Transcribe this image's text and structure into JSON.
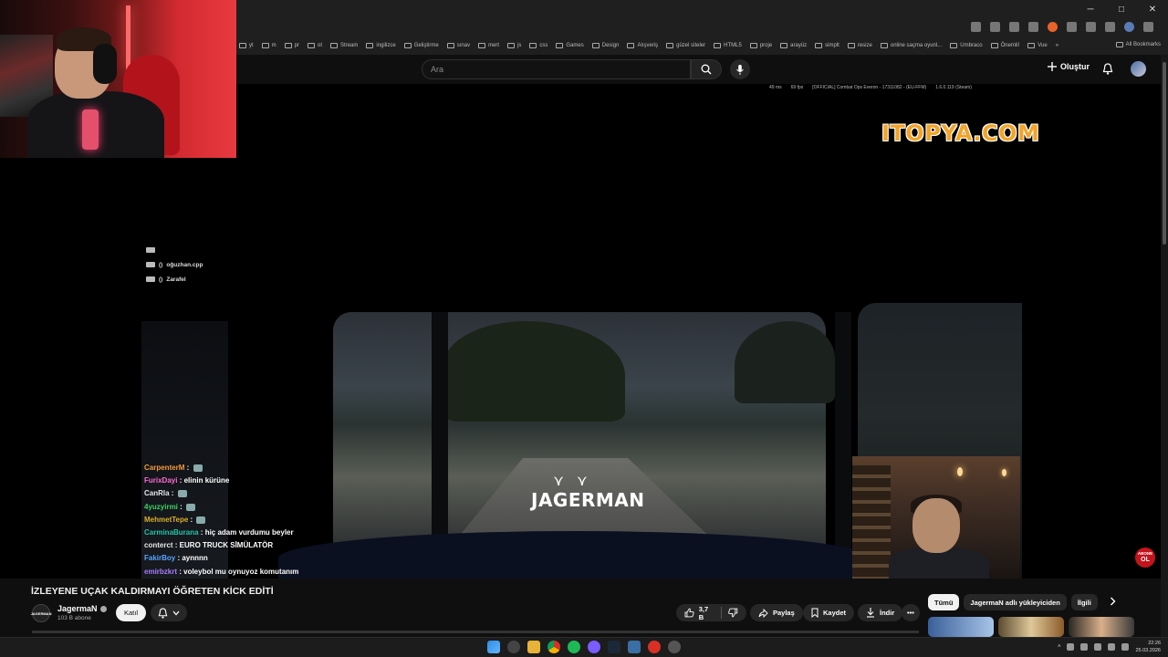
{
  "browser": {
    "controls": [
      "─",
      "□",
      "✕"
    ],
    "bookmarks": [
      "yt",
      "m",
      "pr",
      "ot",
      "Stream",
      "ingilizce",
      "Geliştirme",
      "sınav",
      "mert",
      "js",
      "css",
      "Games",
      "Design",
      "Alışveriş",
      "güzel siteler",
      "HTML5",
      "proje",
      "arayüz",
      "simplt",
      "resize",
      "online saçma oyunl...",
      "Umbraco",
      "Önemli!",
      "Vue",
      "»"
    ],
    "all_bookmarks": "All Bookmarks"
  },
  "yt_header": {
    "search_placeholder": "Ara",
    "create_label": "Oluştur"
  },
  "stream_overlay": {
    "hud": [
      "49 ms",
      "69 fps",
      "[OFFICIAL] Combat Ops Everon - 17311082 - (EU-FFM)",
      "1.6.0.119 (Steam)"
    ],
    "sponsor": "ITOPYA.COM",
    "channel_logo": "JAGERMAN",
    "events": [
      {
        "count": "",
        "name": ""
      },
      {
        "count": "()",
        "name": "oğuzhan.cpp"
      },
      {
        "count": "()",
        "name": "Zarafel"
      }
    ],
    "chat": [
      {
        "user": "CarpenterM",
        "msg": "",
        "color": "#f39a3c",
        "emote": true
      },
      {
        "user": "FurixDayi",
        "msg": "elinin kürüne",
        "color": "#ff6bd6",
        "emote": false
      },
      {
        "user": "CanRla",
        "msg": "",
        "color": "#e7e7e7",
        "emote": true
      },
      {
        "user": "4yuzyirmi",
        "msg": "",
        "color": "#3ecf5f",
        "emote": true
      },
      {
        "user": "MehmetTepe",
        "msg": "",
        "color": "#d8b02a",
        "emote": true
      },
      {
        "user": "CarminaBurana",
        "msg": "hiç adam vurdumu beyler",
        "color": "#22c4a8",
        "emote": false
      },
      {
        "user": "conterct",
        "msg": "EURO TRUCK SİMÜLATÖR",
        "color": "#e7e7e7",
        "emote": false
      },
      {
        "user": "FakirBoy",
        "msg": "aynnnn",
        "color": "#57a6ff",
        "emote": false
      },
      {
        "user": "emirbzkrt",
        "msg": "voleybol mu oynuyoz komutanım",
        "color": "#a87bff",
        "emote": false
      }
    ],
    "subscribe_badge": {
      "top": "ABONE",
      "bottom": "OL"
    }
  },
  "video_info": {
    "title": "İZLEYENE UÇAK KALDIRMAYI ÖĞRETEN KİCK EDİTİ",
    "channel_avatar_text": "JAGERMAN",
    "channel_name": "JagermaN",
    "subscribers": "103 B abone",
    "join_label": "Katıl",
    "likes": "3,7 B",
    "share_label": "Paylaş",
    "save_label": "Kaydet",
    "download_label": "İndir",
    "more_label": "•••"
  },
  "related_chips": [
    "Tümü",
    "JagermaN adlı yükleyiciden",
    "İlgili"
  ],
  "taskbar": {
    "time": "22:26",
    "date": "25.03.2026"
  },
  "colors": {
    "yt_bg": "#0f0f0f",
    "sponsor_orange": "#f2a428",
    "subscribe_red": "#c4141c"
  }
}
